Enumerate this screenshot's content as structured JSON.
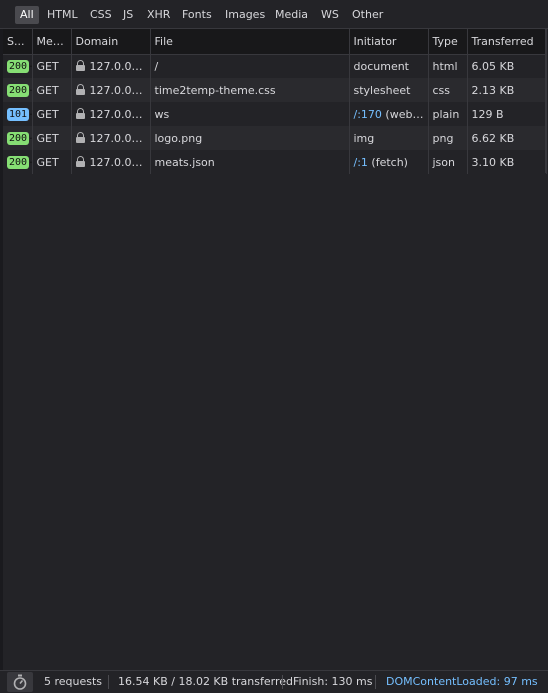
{
  "filters": [
    "All",
    "HTML",
    "CSS",
    "JS",
    "XHR",
    "Fonts",
    "Images",
    "Media",
    "WS",
    "Other"
  ],
  "active_filter": "All",
  "columns": [
    "S...",
    "Met...",
    "Domain",
    "File",
    "Initiator",
    "Type",
    "Transferred"
  ],
  "rows": [
    {
      "status": "200",
      "status_kind": "ok",
      "method": "GET",
      "domain": "127.0.0.1...",
      "file": "/",
      "initiator_link": "",
      "initiator": "document",
      "type": "html",
      "transferred": "6.05 KB"
    },
    {
      "status": "200",
      "status_kind": "ok",
      "method": "GET",
      "domain": "127.0.0.1...",
      "file": "time2temp-theme.css",
      "initiator_link": "",
      "initiator": "stylesheet",
      "type": "css",
      "transferred": "2.13 KB"
    },
    {
      "status": "101",
      "status_kind": "info",
      "method": "GET",
      "domain": "127.0.0.1...",
      "file": "ws",
      "initiator_link": "/:170",
      "initiator": " (webs...",
      "type": "plain",
      "transferred": "129 B"
    },
    {
      "status": "200",
      "status_kind": "ok",
      "method": "GET",
      "domain": "127.0.0.1...",
      "file": "logo.png",
      "initiator_link": "",
      "initiator": "img",
      "type": "png",
      "transferred": "6.62 KB"
    },
    {
      "status": "200",
      "status_kind": "ok",
      "method": "GET",
      "domain": "127.0.0.1...",
      "file": "meats.json",
      "initiator_link": "/:1",
      "initiator": " (fetch)",
      "type": "json",
      "transferred": "3.10 KB"
    }
  ],
  "footer": {
    "requests": "5 requests",
    "transferred": "16.54 KB / 18.02 KB transferred",
    "finish": "Finish: 130 ms",
    "dom_content_loaded": "DOMContentLoaded: 97 ms"
  }
}
